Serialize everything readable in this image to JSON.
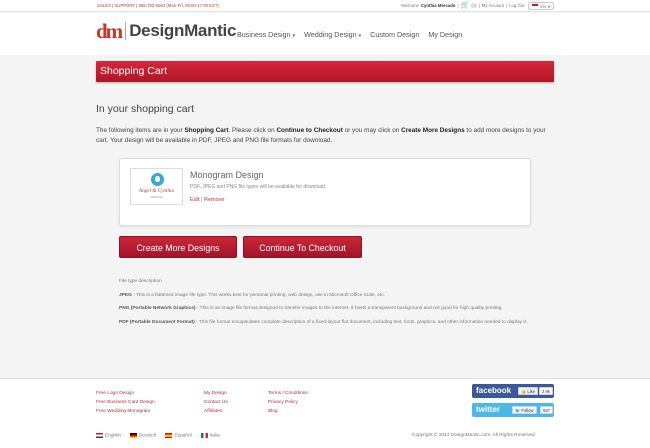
{
  "topbar": {
    "sales_support": "SALES | SUPPORT | 855-702-5563 (Mon-Fri, 09:00-17:00 EST)",
    "welcome": "Welcome",
    "user_name": "Cynthia Mercado",
    "cart_count": "(1)",
    "my_account": "My Account",
    "logout": "Log Out",
    "language": "EN"
  },
  "header": {
    "logo_mark": "dm",
    "logo_text": "DesignMantic",
    "nav": [
      {
        "label": "Business Design",
        "caret": "▾"
      },
      {
        "label": "Wedding Design",
        "caret": "▾"
      },
      {
        "label": "Custom Design"
      },
      {
        "label": "My Design"
      }
    ]
  },
  "banner": {
    "title": "Shopping Cart"
  },
  "main": {
    "section_title": "In your shopping cart",
    "intro_1": "The following items are in your ",
    "intro_cart": "Shopping Cart",
    "intro_2": ". Please click on ",
    "intro_checkout": "Continue to Checkout",
    "intro_3": " or you may click on ",
    "intro_more": "Create More Designs",
    "intro_4": " to add more designs to your cart. Your design will be available in PDF, JPEG and PNG file formats for download."
  },
  "cart_item": {
    "thumb_script": "Angel & Cynthia",
    "thumb_tiny": "WEDDING",
    "title": "Monogram Design",
    "description": "PDF, JPEG and PNG file types will be available for download.",
    "edit": "Edit",
    "separator": "|",
    "remove": "Remove"
  },
  "buttons": {
    "create_more": "Create More Designs",
    "checkout": "Continue To Checkout"
  },
  "file_types": {
    "heading": "File type description",
    "items": [
      {
        "name": "JPEG",
        "desc": " - This is a flattened image file type. This works best for personal printing, web design, use in Microsoft Office Suite, etc."
      },
      {
        "name": "PNG (Portable Network Graphics)",
        "desc": " - This is an image file format designed to transfer images to the internet. It hosts a transparent background and not good for high quality printing."
      },
      {
        "name": "PDF (Portable Document Format)",
        "desc": " - This file format encapsulates complete description of a fixed-layout flat document, including text, fonts, graphics, and other information needed to display it."
      }
    ]
  },
  "footer": {
    "col1": [
      "Free Logo Design",
      "Free Business Card Design",
      "Free Wedding Monogram"
    ],
    "col2": [
      "My Design",
      "Contact Us",
      "Affiliates"
    ],
    "col3": [
      "Terms / Conditions",
      "Privacy Policy",
      "Blog"
    ],
    "facebook": {
      "brand": "facebook",
      "like": "Like",
      "count": "2.9k"
    },
    "twitter": {
      "brand": "twitter",
      "follow": "Follow",
      "count": "587"
    },
    "languages": [
      "English",
      "Deutsch",
      "Español",
      "Italia"
    ],
    "copyright": "Copyright © 2014 DesignMantic.com. All Rights Reserved"
  }
}
